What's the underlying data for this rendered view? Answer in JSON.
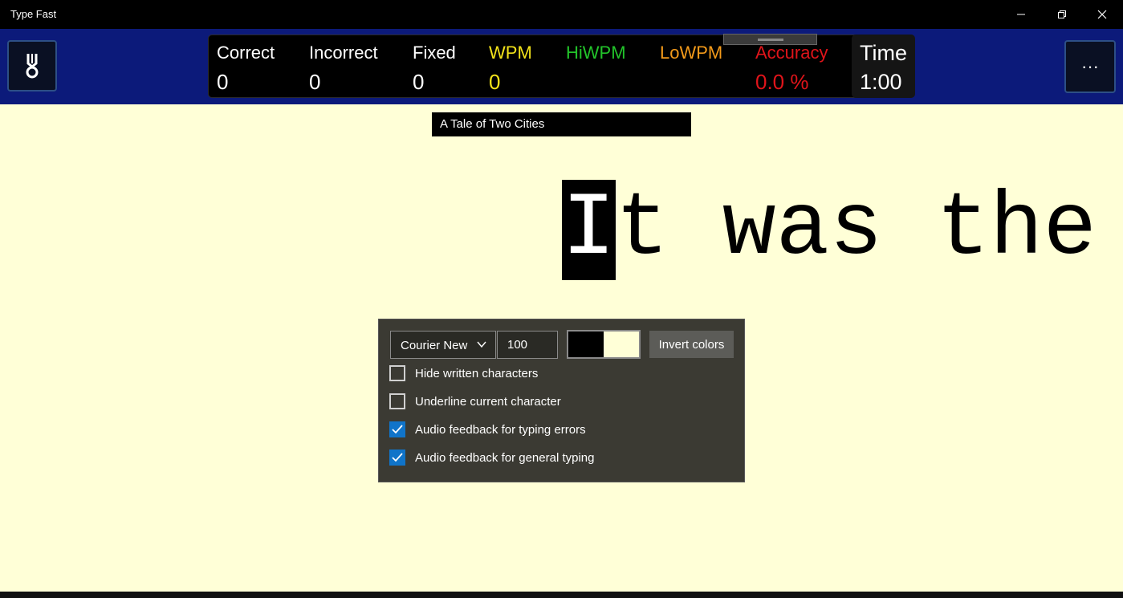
{
  "window": {
    "title": "Type Fast",
    "minimize_icon": "minimize-icon",
    "restore_icon": "restore-icon",
    "close_icon": "close-icon"
  },
  "header": {
    "medal_icon": "medal-icon",
    "more_label": "···",
    "stats": [
      {
        "label": "Correct",
        "value": "0",
        "color": "#ffffff"
      },
      {
        "label": "Incorrect",
        "value": "0",
        "color": "#ffffff"
      },
      {
        "label": "Fixed",
        "value": "0",
        "color": "#ffffff"
      },
      {
        "label": "WPM",
        "value": "0",
        "color": "#f2e21a"
      },
      {
        "label": "HiWPM",
        "value": "",
        "color": "#22c32a"
      },
      {
        "label": "LoWPM",
        "value": "",
        "color": "#f39a1a"
      },
      {
        "label": "Accuracy",
        "value": "0.0 %",
        "color": "#e0141a"
      }
    ],
    "time": {
      "label": "Time",
      "value": "1:00"
    }
  },
  "book": {
    "title": "A Tale of Two Cities"
  },
  "typing": {
    "current_char": "I",
    "remaining_text": "t was the"
  },
  "settings": {
    "font_family": "Courier New",
    "font_size": "100",
    "foreground_color": "#000000",
    "background_color": "#ffffd7",
    "invert_label": "Invert colors",
    "options": [
      {
        "label": "Hide written characters",
        "checked": false
      },
      {
        "label": "Underline current character",
        "checked": false
      },
      {
        "label": "Audio feedback for typing errors",
        "checked": true
      },
      {
        "label": "Audio feedback for general typing",
        "checked": true
      }
    ]
  }
}
